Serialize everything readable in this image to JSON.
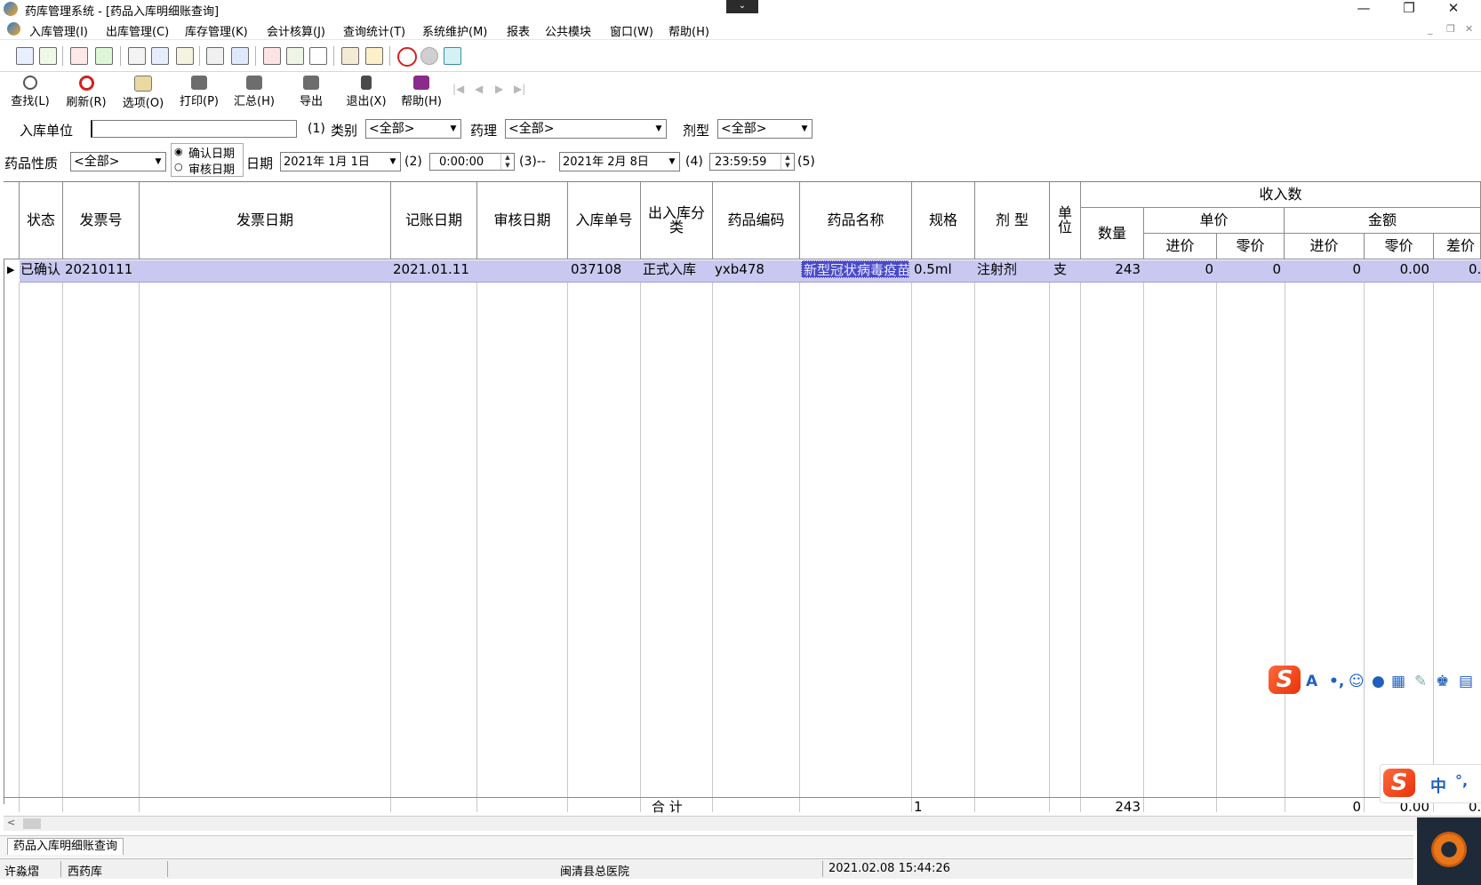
{
  "window": {
    "title": "药库管理系统 - [药品入库明细账查询]",
    "controls": {
      "minimize": "—",
      "restore": "❐",
      "close": "✕"
    }
  },
  "menu": [
    "入库管理(I)",
    "出库管理(C)",
    "库存管理(K)",
    "会计核算(J)",
    "查询统计(T)",
    "系统维护(M)",
    "报表",
    "公共模块",
    "窗口(W)",
    "帮助(H)"
  ],
  "toolbar": {
    "find": "查找(L)",
    "refresh": "刷新(R)",
    "options": "选项(O)",
    "print": "打印(P)",
    "summary": "汇总(H)",
    "export": "导出",
    "exit": "退出(X)",
    "help": "帮助(H)",
    "nav": [
      "|◀",
      "◀",
      "▶",
      "▶|"
    ]
  },
  "filters": {
    "warehouse_label": "入库单位",
    "warehouse_value": "",
    "hint1": "(1)",
    "category_label": "类别",
    "category_value": "<全部>",
    "pharmacology_label": "药理",
    "pharmacology_value": "<全部>",
    "dosage_label": "剂型",
    "dosage_value": "<全部>",
    "property_label": "药品性质",
    "property_value": "<全部>",
    "radio_confirm": "确认日期",
    "radio_audit": "审核日期",
    "date_label": "日期",
    "date_from": "2021年 1月 1日",
    "hint2": "(2)",
    "time_from": "0:00:00",
    "hint3": "(3)--",
    "date_to": "2021年 2月 8日",
    "hint4": "(4)",
    "time_to": "23:59:59",
    "hint5": "(5)"
  },
  "grid": {
    "headers": {
      "status": "状态",
      "invoice_no": "发票号",
      "invoice_date": "发票日期",
      "post_date": "记账日期",
      "audit_date": "审核日期",
      "inbound_no": "入库单号",
      "io_type": "出入库分类",
      "drug_code": "药品编码",
      "drug_name": "药品名称",
      "spec": "规格",
      "dosage": "剂 型",
      "unit": "单位",
      "receipt": "收入数",
      "qty": "数量",
      "unit_price": "单价",
      "amount": "金额",
      "purchase_price": "进价",
      "retail_price": "零价",
      "purchase_price2": "进价",
      "retail_price2": "零价",
      "diff_price": "差价"
    },
    "rows": [
      {
        "status": "已确认",
        "invoice_no": "20210111",
        "invoice_date": "",
        "post_date": "2021.01.11",
        "audit_date": "",
        "inbound_no": "037108",
        "io_type": "正式入库",
        "drug_code": "yxb478",
        "drug_name": "新型冠状病毒疫苗",
        "spec": "0.5ml",
        "dosage": "注射剂",
        "unit": "支",
        "qty": "243",
        "unit_purchase": "0",
        "unit_retail": "0",
        "amount_purchase": "0",
        "amount_retail": "0.00",
        "amount_diff": "0."
      }
    ],
    "totals": {
      "label": "合 计",
      "count": "1",
      "qty": "243",
      "amount_purchase": "0",
      "amount_retail": "0.00",
      "amount_diff": "0."
    }
  },
  "tabs": [
    "药品入库明细账查询"
  ],
  "statusbar": {
    "user": "许淼熠",
    "warehouse": "西药库",
    "hospital": "闽清县总医院",
    "datetime": "2021.02.08 15:44:26"
  },
  "ime": {
    "lang": "中",
    "punct": "°,"
  }
}
